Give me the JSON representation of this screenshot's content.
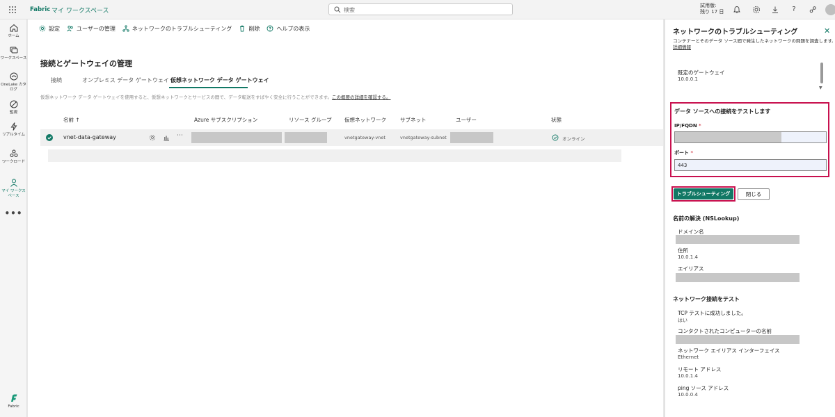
{
  "topbar": {
    "brand": "Fabric",
    "workspace": "マイ ワークスペース",
    "search_placeholder": "検索",
    "trial_line1": "試用版:",
    "trial_line2": "残り 17 日"
  },
  "nav": {
    "items": [
      {
        "label": "ホーム"
      },
      {
        "label": "ワークスペース"
      },
      {
        "label": "OneLake カタログ"
      },
      {
        "label": "監視"
      },
      {
        "label": "リアルタイム"
      },
      {
        "label": "ワークロード"
      },
      {
        "label": "マイ ワークスペース"
      }
    ],
    "more": "•••",
    "footer_label": "Fabric"
  },
  "toolbar": {
    "settings": "設定",
    "manage_users": "ユーザーの管理",
    "troubleshoot": "ネットワークのトラブルシューティング",
    "delete": "削除",
    "help": "ヘルプの表示"
  },
  "page": {
    "title": "接続とゲートウェイの管理",
    "tabs": [
      "接続",
      "オンプレミス データ ゲートウェイ",
      "仮想ネットワーク データ ゲートウェイ"
    ],
    "description": "仮想ネットワーク データ ゲートウェイを使用すると、仮想ネットワークとサービスの間で、データ転送をすばやく安全に行うことができます。",
    "description_link": "この概要の詳細を確認する。"
  },
  "table": {
    "headers": [
      "名前 ↑",
      "Azure サブスクリプション",
      "リソース グループ",
      "仮想ネットワーク",
      "サブネット",
      "ユーザー",
      "状態"
    ],
    "row": {
      "name": "vnet-data-gateway",
      "vnet": "vnetgateway-vnet",
      "subnet": "vnetgateway-subnet",
      "status": "オンライン"
    }
  },
  "panel": {
    "title": "ネットワークのトラブルシューティング",
    "subtitle": "コンテナーとそのデータ ソース間で発生したネットワークの問題を調査します。",
    "subtitle_link": "詳細情報",
    "gateway_label": "既定のゲートウェイ",
    "gateway_value": "10.0.0.1",
    "test_title": "データ ソースへの接続をテストします",
    "ip_label": "IP/FQDN",
    "port_label": "ポート",
    "port_value": "443",
    "required_mark": "*",
    "troubleshoot_button": "トラブルシューティング",
    "close_button": "閉じる",
    "nslookup_title": "名前の解決 (NSLookup)",
    "domain_label": "ドメイン名",
    "address_label": "住所",
    "address_value": "10.0.1.4",
    "alias_label": "エイリアス",
    "nettest_title": "ネットワーク接続をテスト",
    "tcp_label": "TCP テストに成功しました。",
    "tcp_value": "はい",
    "computer_label": "コンタクトされたコンピューターの名前",
    "interface_label": "ネットワーク エイリアス インターフェイス",
    "interface_value": "Ethernet",
    "remote_label": "リモート アドレス",
    "remote_value": "10.0.1.4",
    "ping_label": "ping ソース アドレス",
    "ping_value": "10.0.0.4"
  },
  "colors": {
    "accent": "#117865",
    "highlight_border": "#c8104e"
  }
}
